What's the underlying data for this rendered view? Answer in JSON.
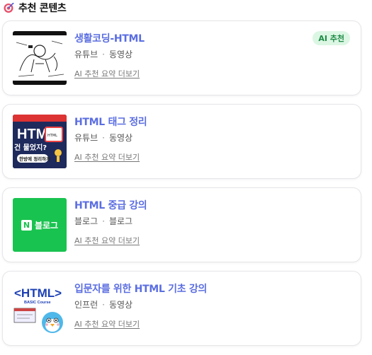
{
  "section": {
    "title": "추천 콘텐츠",
    "icon": "target-icon"
  },
  "colors": {
    "title_link": "#5b6ee1",
    "ai_badge_bg": "#dcf6e4",
    "ai_badge_text": "#1f8b47",
    "naver_green": "#19c34f"
  },
  "cards": [
    {
      "title": "생활코딩-HTML",
      "source": "유튜브",
      "type": "동영상",
      "summary_link": "AI 추천 요약 더보기",
      "badge": "AI 추천"
    },
    {
      "title": "HTML 태그 정리",
      "source": "유튜브",
      "type": "동영상",
      "summary_link": "AI 추천 요약 더보기",
      "thumb_text": [
        "HTML",
        "건 물었지?",
        "한방에 정리하자"
      ]
    },
    {
      "title": "HTML 중급 강의",
      "source": "블로그",
      "type": "블로그",
      "summary_link": "AI 추천 요약 더보기",
      "thumb_text": [
        "N",
        "블로그"
      ]
    },
    {
      "title": "입문자를 위한 HTML 기초 강의",
      "source": "인프런",
      "type": "동영상",
      "summary_link": "AI 추천 요약 더보기",
      "thumb_text": [
        "<HTML>",
        "BASIC Course"
      ]
    }
  ]
}
